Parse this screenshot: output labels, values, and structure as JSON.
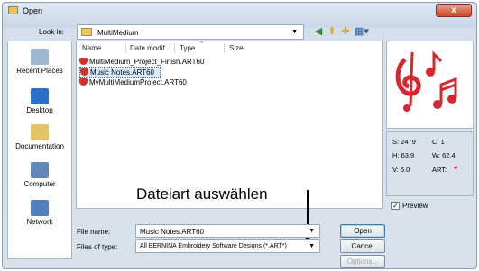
{
  "window": {
    "title": "Open",
    "close_label": "x"
  },
  "toolbar": {
    "look_in_label": "Look in:",
    "look_in_value": "MultiMedium"
  },
  "places": [
    {
      "label": "Recent Places",
      "icon": "recent-places-icon"
    },
    {
      "label": "Desktop",
      "icon": "desktop-icon"
    },
    {
      "label": "Documentation",
      "icon": "documentation-icon"
    },
    {
      "label": "Computer",
      "icon": "computer-icon"
    },
    {
      "label": "Network",
      "icon": "network-icon"
    }
  ],
  "file_list": {
    "columns": [
      "Name",
      "Date modif...",
      "Type",
      "Size"
    ],
    "rows": [
      {
        "name": "MultiMedium_Project_Finish.ART60",
        "selected": false
      },
      {
        "name": "Music Notes.ART60",
        "selected": true
      },
      {
        "name": "MyMultiMediumProject.ART60",
        "selected": false
      }
    ]
  },
  "info": {
    "s": "S: 2479",
    "c": "C: 1",
    "h": "H: 63.9",
    "w": "W: 62.4",
    "v": "V: 6.0",
    "art": "ART:"
  },
  "callout": {
    "text": "Dateiart auswählen"
  },
  "form": {
    "file_name_label": "File name:",
    "file_name_value": "Music Notes.ART60",
    "files_of_type_label": "Files of type:",
    "files_of_type_value": "All BERNINA Embroidery Software Designs (*.ART*)"
  },
  "buttons": {
    "open": "Open",
    "cancel": "Cancel",
    "options": "Options..."
  },
  "preview_checkbox": {
    "label": "Preview",
    "checked": true
  },
  "colors": {
    "accent": "#dcebfb",
    "heart": "#e02020",
    "music": "#d7262e"
  }
}
